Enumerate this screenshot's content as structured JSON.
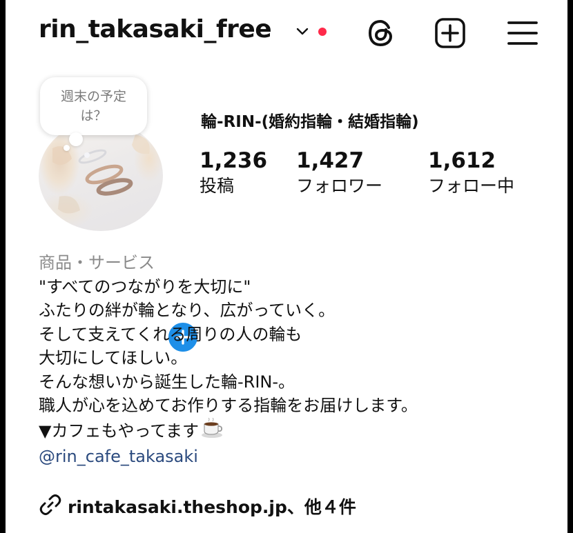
{
  "header": {
    "username": "rin_takasaki_free",
    "icons": [
      "chevron-down-icon",
      "notification-dot",
      "threads-icon",
      "new-post-icon",
      "menu-icon"
    ],
    "accent_red": "#ff2a4a"
  },
  "profile": {
    "note_line1": "週末の予定",
    "note_line2": "は？",
    "display_name": "輪-RIN-(婚約指輪・結婚指輪)",
    "badge_color": "#1e8fe8",
    "stats": [
      {
        "value": "1,236",
        "label": "投稿"
      },
      {
        "value": "1,427",
        "label": "フォロワー"
      },
      {
        "value": "1,612",
        "label": "フォロー中"
      }
    ]
  },
  "bio": {
    "category": "商品・サービス",
    "lines": [
      "\"すべてのつながりを大切に\"",
      "ふたりの絆が輪となり、広がっていく。",
      "そして支えてくれる周りの人の輪も",
      "大切にしてほしい。",
      "そんな想いから誕生した輪-RIN-。",
      "職人が心を込めてお作りする指輪をお届けします。",
      "▼カフェもやってます"
    ],
    "mention": "@rin_cafe_takasaki",
    "mention_color": "#2b4a7e",
    "link": "rintakasaki.theshop.jp、他４件"
  }
}
